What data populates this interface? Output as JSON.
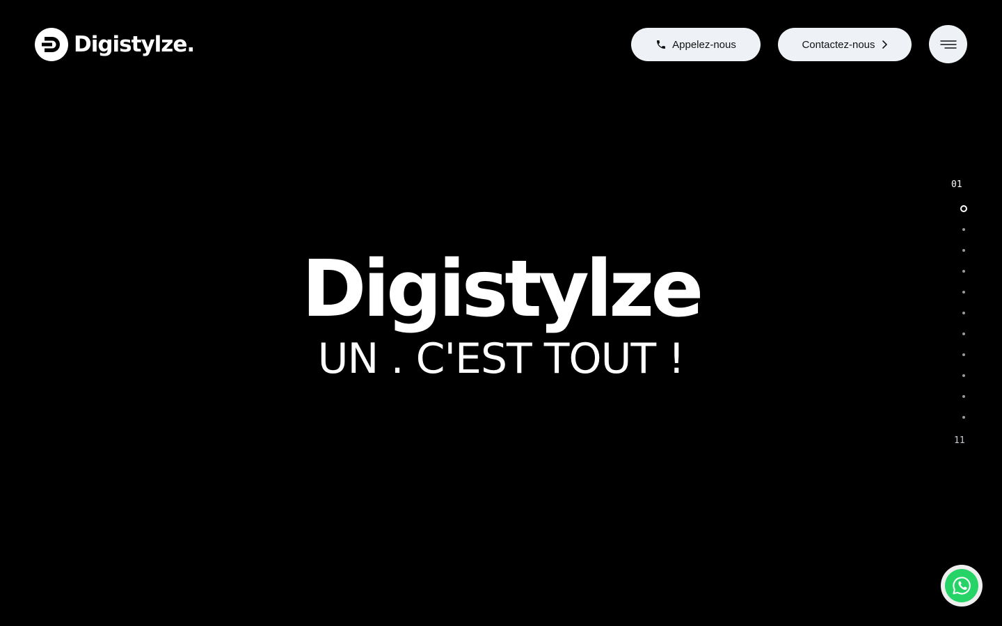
{
  "header": {
    "logo_text": "Digistylze.",
    "call_button_label": "Appelez-nous",
    "contact_button_label": "Contactez-nous"
  },
  "hero": {
    "title": "Digistylze",
    "subtitle": "UN . C'EST TOUT !"
  },
  "pager": {
    "current_label": "01",
    "total_label": "11",
    "active_index": 0,
    "dot_count": 11
  },
  "icons": {
    "logo": "digistylze-logo-icon",
    "call": "phone-icon",
    "contact": "chevron-right-icon",
    "menu": "hamburger-menu-icon",
    "whatsapp": "whatsapp-icon"
  },
  "colors": {
    "background": "#000000",
    "text": "#ffffff",
    "button_bg": "#eef2f6",
    "button_text": "#111111",
    "whatsapp_green": "#25d366",
    "dot": "#9a9a9a"
  }
}
